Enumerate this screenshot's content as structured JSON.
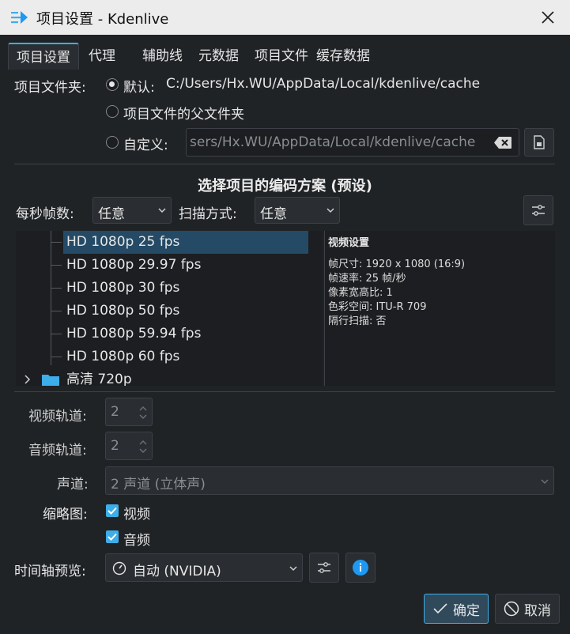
{
  "window": {
    "title": "项目设置 - Kdenlive"
  },
  "tabs": [
    "项目设置",
    "代理",
    "辅助线",
    "元数据",
    "项目文件",
    "缓存数据"
  ],
  "project_folder": {
    "label": "项目文件夹:",
    "default_label": "默认:",
    "default_path": "C:/Users/Hx.WU/AppData/Local/kdenlive/cache",
    "parent_label": "项目文件的父文件夹",
    "custom_label": "自定义:",
    "custom_path": "sers/Hx.WU/AppData/Local/kdenlive/cache"
  },
  "profile": {
    "heading": "选择项目的编码方案 (预设)",
    "fps_label": "每秒帧数:",
    "fps_value": "任意",
    "scan_label": "扫描方式:",
    "scan_value": "任意",
    "tree_items": [
      "HD 1080p 25 fps",
      "HD 1080p 29.97 fps",
      "HD 1080p 30 fps",
      "HD 1080p 50 fps",
      "HD 1080p 59.94 fps",
      "HD 1080p 60 fps"
    ],
    "tree_next_group": "高清 720p",
    "info_title": "视频设置",
    "info_lines": [
      "帧尺寸: 1920 x 1080 (16:9)",
      "帧速率: 25 帧/秒",
      "像素宽高比: 1",
      "色彩空间: ITU-R 709",
      "隔行扫描: 否"
    ]
  },
  "tracks": {
    "video_label": "视频轨道:",
    "video_value": "2",
    "audio_label": "音频轨道:",
    "audio_value": "2",
    "channels_label": "声道:",
    "channels_value": "2 声道 (立体声)"
  },
  "thumbnails": {
    "label": "缩略图:",
    "video": "视频",
    "audio": "音频"
  },
  "timeline_preview": {
    "label": "时间轴预览:",
    "value": "自动 (NVIDIA)"
  },
  "buttons": {
    "ok": "确定",
    "cancel": "取消"
  },
  "colors": {
    "accent": "#3daee9",
    "background": "#202326",
    "titlebar": "#ececec"
  }
}
